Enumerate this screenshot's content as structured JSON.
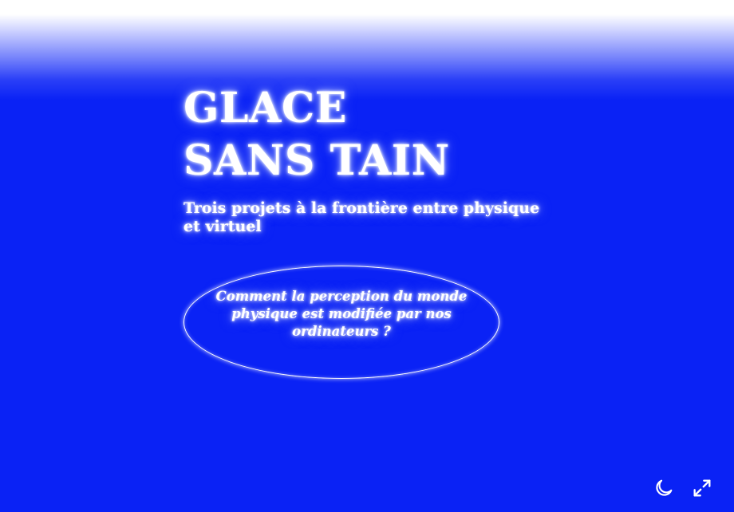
{
  "hero": {
    "title_line1": "GLACE",
    "title_line2": "SANS TAIN",
    "subtitle": "Trois projets à la frontière entre physique et virtuel",
    "question": "Comment la perception du monde physique est modifiée par nos ordinateurs ?"
  },
  "controls": {
    "dark_mode_icon": "moon-icon",
    "fullscreen_icon": "expand-icon"
  },
  "colors": {
    "background": "#0a22f5",
    "text": "#ffffff"
  }
}
